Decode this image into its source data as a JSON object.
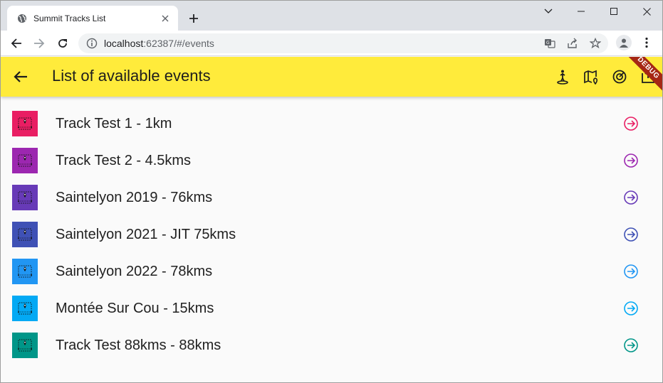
{
  "browser": {
    "tab_title": "Summit Tracks List",
    "url_host": "localhost",
    "url_rest": ":62387/#/events"
  },
  "appbar": {
    "title": "List of available events",
    "background": "#ffeb3b",
    "debug_label": "DEBUG"
  },
  "events": [
    {
      "label": "Track Test 1 - 1km",
      "color": "#e91e63"
    },
    {
      "label": "Track Test 2 - 4.5kms",
      "color": "#9c27b0"
    },
    {
      "label": "Saintelyon 2019 - 76kms",
      "color": "#673ab7"
    },
    {
      "label": "Saintelyon 2021 - JIT 75kms",
      "color": "#3f51b5"
    },
    {
      "label": "Saintelyon 2022 - 78kms",
      "color": "#2196f3"
    },
    {
      "label": "Montée Sur Cou - 15kms",
      "color": "#03a9f4"
    },
    {
      "label": "Track Test 88kms - 88kms",
      "color": "#009688"
    }
  ],
  "icons": {
    "tab": "globe-icon",
    "close": "close-icon",
    "new_tab": "plus-icon",
    "back": "arrow-left-icon",
    "forward": "arrow-right-icon",
    "reload": "reload-icon",
    "info": "info-icon",
    "translate": "translate-icon",
    "share": "share-icon",
    "bookmark": "star-icon",
    "profile": "profile-icon",
    "menu": "kebab-menu-icon",
    "app_actions": [
      "hiker-pin-icon",
      "map-pin-icon",
      "target-icon",
      "export-icon"
    ],
    "row_thumb": "route-map-icon",
    "row_arrow": "arrow-circle-right-icon"
  }
}
